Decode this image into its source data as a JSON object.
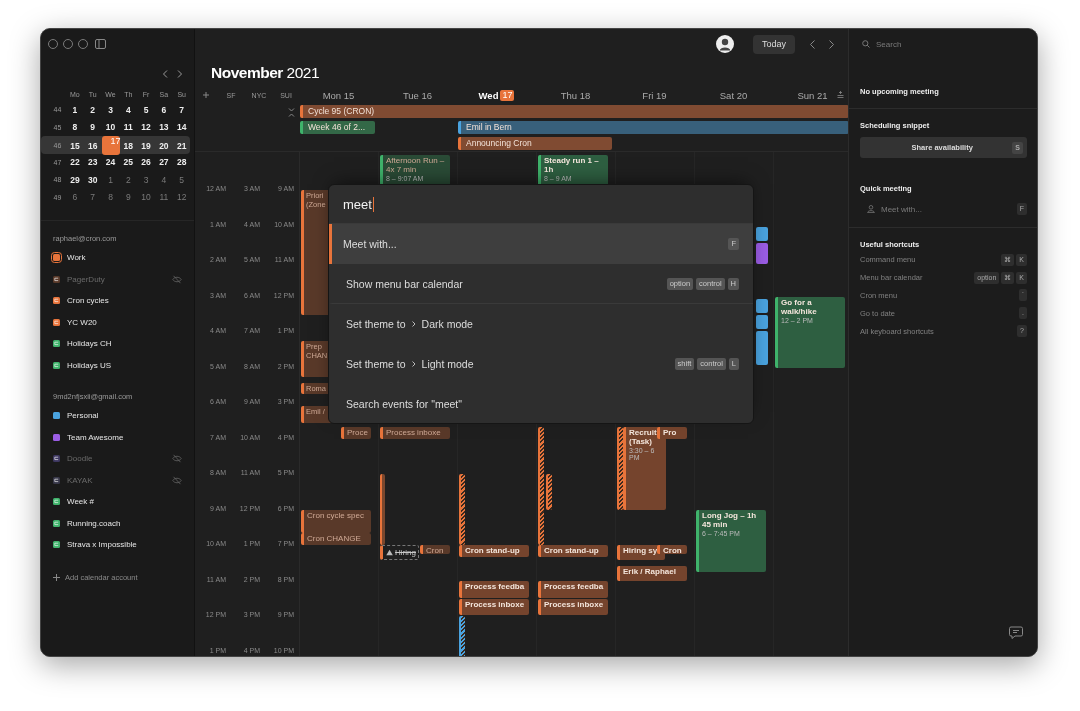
{
  "sidebar": {
    "mini_calendar": {
      "weekdays": [
        "Mo",
        "Tu",
        "We",
        "Th",
        "Fr",
        "Sa",
        "Su"
      ],
      "weeks": [
        {
          "number": "44",
          "selected": false,
          "days": [
            {
              "label": "1",
              "muted": false,
              "today": false
            },
            {
              "label": "2",
              "muted": false,
              "today": false
            },
            {
              "label": "3",
              "muted": false,
              "today": false
            },
            {
              "label": "4",
              "muted": false,
              "today": false
            },
            {
              "label": "5",
              "muted": false,
              "today": false
            },
            {
              "label": "6",
              "muted": false,
              "today": false
            },
            {
              "label": "7",
              "muted": false,
              "today": false
            }
          ]
        },
        {
          "number": "45",
          "selected": false,
          "days": [
            {
              "label": "8",
              "muted": false,
              "today": false
            },
            {
              "label": "9",
              "muted": false,
              "today": false
            },
            {
              "label": "10",
              "muted": false,
              "today": false
            },
            {
              "label": "11",
              "muted": false,
              "today": false
            },
            {
              "label": "12",
              "muted": false,
              "today": false
            },
            {
              "label": "13",
              "muted": false,
              "today": false
            },
            {
              "label": "14",
              "muted": false,
              "today": false
            }
          ]
        },
        {
          "number": "46",
          "selected": true,
          "days": [
            {
              "label": "15",
              "muted": false,
              "today": false
            },
            {
              "label": "16",
              "muted": false,
              "today": false
            },
            {
              "label": "17",
              "muted": false,
              "today": true
            },
            {
              "label": "18",
              "muted": false,
              "today": false
            },
            {
              "label": "19",
              "muted": false,
              "today": false
            },
            {
              "label": "20",
              "muted": false,
              "today": false
            },
            {
              "label": "21",
              "muted": false,
              "today": false
            }
          ]
        },
        {
          "number": "47",
          "selected": false,
          "days": [
            {
              "label": "22",
              "muted": false,
              "today": false
            },
            {
              "label": "23",
              "muted": false,
              "today": false
            },
            {
              "label": "24",
              "muted": false,
              "today": false
            },
            {
              "label": "25",
              "muted": false,
              "today": false
            },
            {
              "label": "26",
              "muted": false,
              "today": false
            },
            {
              "label": "27",
              "muted": false,
              "today": false
            },
            {
              "label": "28",
              "muted": false,
              "today": false
            }
          ]
        },
        {
          "number": "48",
          "selected": false,
          "days": [
            {
              "label": "29",
              "muted": false,
              "today": false
            },
            {
              "label": "30",
              "muted": false,
              "today": false
            },
            {
              "label": "1",
              "muted": true,
              "today": false
            },
            {
              "label": "2",
              "muted": true,
              "today": false
            },
            {
              "label": "3",
              "muted": true,
              "today": false
            },
            {
              "label": "4",
              "muted": true,
              "today": false
            },
            {
              "label": "5",
              "muted": true,
              "today": false
            }
          ]
        },
        {
          "number": "49",
          "selected": false,
          "days": [
            {
              "label": "6",
              "muted": true,
              "today": false
            },
            {
              "label": "7",
              "muted": true,
              "today": false
            },
            {
              "label": "8",
              "muted": true,
              "today": false
            },
            {
              "label": "9",
              "muted": true,
              "today": false
            },
            {
              "label": "10",
              "muted": true,
              "today": false
            },
            {
              "label": "11",
              "muted": true,
              "today": false
            },
            {
              "label": "12",
              "muted": true,
              "today": false
            }
          ]
        }
      ]
    },
    "accounts": [
      {
        "email": "raphael@cron.com",
        "calendars": [
          {
            "name": "Work",
            "color": "#e8743b",
            "kind": "plain",
            "selected": true,
            "hidden": false
          },
          {
            "name": "PagerDuty",
            "color": "#5a3a2a",
            "kind": "synced",
            "selected": false,
            "hidden": true
          },
          {
            "name": "Cron cycles",
            "color": "#e8743b",
            "kind": "synced",
            "selected": false,
            "hidden": false
          },
          {
            "name": "YC W20",
            "color": "#e8743b",
            "kind": "synced",
            "selected": false,
            "hidden": false
          },
          {
            "name": "Holidays CH",
            "color": "#3fb36b",
            "kind": "synced",
            "selected": false,
            "hidden": false
          },
          {
            "name": "Holidays US",
            "color": "#3fb36b",
            "kind": "synced",
            "selected": false,
            "hidden": false
          }
        ]
      },
      {
        "email": "9md2nfjsxii@gmail.com",
        "calendars": [
          {
            "name": "Personal",
            "color": "#4aa3df",
            "kind": "plain",
            "selected": false,
            "hidden": false
          },
          {
            "name": "Team Awesome",
            "color": "#9b5de5",
            "kind": "plain",
            "selected": false,
            "hidden": false
          },
          {
            "name": "Doodle",
            "color": "#3d3760",
            "kind": "synced",
            "selected": false,
            "hidden": true
          },
          {
            "name": "KAYAK",
            "color": "#38384a",
            "kind": "synced",
            "selected": false,
            "hidden": true
          },
          {
            "name": "Week #",
            "color": "#3fb36b",
            "kind": "synced",
            "selected": false,
            "hidden": false
          },
          {
            "name": "Running.coach",
            "color": "#3fb36b",
            "kind": "synced",
            "selected": false,
            "hidden": false
          },
          {
            "name": "Strava x Impossible",
            "color": "#3fb36b",
            "kind": "synced",
            "selected": false,
            "hidden": false
          }
        ]
      }
    ],
    "add_account": "Add calendar account"
  },
  "header": {
    "month_title": "**November** 2021",
    "today_button": "Today"
  },
  "timezones": [
    "SF",
    "NYC",
    "SUI"
  ],
  "days": [
    {
      "name": "Mon",
      "date": "15",
      "today": false,
      "all_day": [
        {
          "title": "Cycle 95 (CRON)",
          "color": "#e8743b"
        },
        {
          "title": "Week 46 of 2...",
          "color": "#3fb36b"
        }
      ],
      "events": [
        {
          "title": "Priori (Zone",
          "color": "#e8743b",
          "kind": "covered",
          "past": true
        },
        {
          "title": "Prep CHAN",
          "color": "#e8743b",
          "kind": "covered",
          "past": true
        },
        {
          "title": "Roma",
          "color": "#e8743b",
          "kind": "covered",
          "past": true
        },
        {
          "title": "Emil /",
          "color": "#e8743b",
          "kind": "covered",
          "past": true
        },
        {
          "title": "Proce",
          "color": "#e8743b",
          "kind": "side",
          "past": true
        },
        {
          "title": "Cron cycle spec",
          "color": "#e8743b",
          "kind": "block",
          "past": true
        },
        {
          "title": "Cron CHANGE",
          "color": "#e8743b",
          "kind": "block",
          "past": true
        }
      ]
    },
    {
      "name": "Tue",
      "date": "16",
      "today": false,
      "events": [
        {
          "title": "Afternoon Run – 4x 7 min",
          "time": "8 – 9:07 AM",
          "color": "#3fb36b",
          "kind": "block",
          "past": true
        },
        {
          "title": "Process inboxe",
          "color": "#e8743b",
          "kind": "block",
          "past": true
        },
        {
          "color": "#e8743b",
          "kind": "bar",
          "past": true
        },
        {
          "title": "Hiring",
          "color": "#e8743b",
          "kind": "tentative",
          "past": true
        },
        {
          "title": "Cron",
          "color": "#e8743b",
          "kind": "side",
          "past": true
        }
      ]
    },
    {
      "name": "Wed",
      "date": "17",
      "today": true,
      "all_day": [
        {
          "title": "Emil in Bern",
          "color": "#4aa3df"
        },
        {
          "title": "Announcing Cron",
          "color": "#e8743b"
        }
      ],
      "events": [
        {
          "color": "#e8743b",
          "kind": "stripe",
          "past": false
        },
        {
          "title": "Cron stand-up",
          "color": "#e8743b",
          "kind": "block",
          "past": false
        },
        {
          "title": "Process feedba",
          "color": "#e8743b",
          "kind": "block",
          "past": false
        },
        {
          "title": "Process inboxe",
          "color": "#e8743b",
          "kind": "block",
          "past": false
        },
        {
          "color": "#4aa3df",
          "kind": "stripe",
          "past": false
        }
      ]
    },
    {
      "name": "Thu",
      "date": "18",
      "today": false,
      "events": [
        {
          "title": "Steady run 1 – 1h",
          "time": "8 – 9 AM",
          "color": "#3fb36b",
          "kind": "block",
          "past": false
        },
        {
          "color": "#e8743b",
          "kind": "stripe",
          "past": false
        },
        {
          "color": "#e8743b",
          "kind": "stripe_inset",
          "past": false
        },
        {
          "title": "Cron stand-up",
          "color": "#e8743b",
          "kind": "block",
          "past": false
        },
        {
          "title": "Process feedba",
          "color": "#e8743b",
          "kind": "block",
          "past": false
        },
        {
          "title": "Process inboxe",
          "color": "#e8743b",
          "kind": "block",
          "past": false
        }
      ]
    },
    {
      "name": "Fri",
      "date": "19",
      "today": false,
      "events": [
        {
          "color": "#e8743b",
          "kind": "stripe",
          "past": false
        },
        {
          "title": "Recruit (Task)",
          "time": "3:30 – 6 PM",
          "color": "#e8743b",
          "kind": "inset",
          "past": false
        },
        {
          "title": "Pro",
          "color": "#e8743b",
          "kind": "side",
          "past": false
        },
        {
          "title": "Hiring sy",
          "color": "#e8743b",
          "kind": "main",
          "past": false
        },
        {
          "title": "Cron",
          "color": "#e8743b",
          "kind": "side",
          "past": false
        },
        {
          "title": "Erik / Raphael",
          "color": "#e8743b",
          "kind": "block",
          "past": false
        }
      ]
    },
    {
      "name": "Sat",
      "date": "20",
      "today": false,
      "events": [
        {
          "color": "#4aa3df",
          "kind": "clipped",
          "past": false
        },
        {
          "color": "#9b5de5",
          "kind": "clipped",
          "past": false
        },
        {
          "color": "#4aa3df",
          "kind": "clipped",
          "past": false
        },
        {
          "color": "#4aa3df",
          "kind": "clipped",
          "past": false
        },
        {
          "color": "#4aa3df",
          "kind": "clipped",
          "past": false
        },
        {
          "title": "Long Jog – 1h 45 min",
          "time": "6 – 7:45 PM",
          "color": "#3fb36b",
          "kind": "block",
          "past": false
        }
      ]
    },
    {
      "name": "Sun",
      "date": "21",
      "today": false,
      "events": [
        {
          "title": "Go for a walk/hike",
          "time": "12 – 2 PM",
          "color": "#3fb36b",
          "kind": "block",
          "past": false
        }
      ]
    }
  ],
  "time_rows": [
    [
      "12 AM",
      "3 AM",
      "9 AM"
    ],
    [
      "1 AM",
      "4 AM",
      "10 AM"
    ],
    [
      "2 AM",
      "5 AM",
      "11 AM"
    ],
    [
      "3 AM",
      "6 AM",
      "12 PM"
    ],
    [
      "4 AM",
      "7 AM",
      "1 PM"
    ],
    [
      "5 AM",
      "8 AM",
      "2 PM"
    ],
    [
      "6 AM",
      "9 AM",
      "3 PM"
    ],
    [
      "7 AM",
      "10 AM",
      "4 PM"
    ],
    [
      "8 AM",
      "11 AM",
      "5 PM"
    ],
    [
      "9 AM",
      "12 PM",
      "6 PM"
    ],
    [
      "10 AM",
      "1 PM",
      "7 PM"
    ],
    [
      "11 AM",
      "2 PM",
      "8 PM"
    ],
    [
      "12 PM",
      "3 PM",
      "9 PM"
    ],
    [
      "1 PM",
      "4 PM",
      "10 PM"
    ]
  ],
  "command_menu": {
    "query": "meet",
    "items": [
      {
        "label": "Meet with...",
        "selected": true,
        "section_end": false,
        "keys": [
          "F"
        ]
      },
      {
        "label": "Show menu bar calendar",
        "selected": false,
        "section_end": true,
        "keys": [
          "option",
          "control",
          "H"
        ]
      },
      {
        "label": "Set theme to",
        "target": "Dark mode",
        "selected": false,
        "section_end": false
      },
      {
        "label": "Set theme to",
        "target": "Light mode",
        "selected": false,
        "section_end": false,
        "keys": [
          "shift",
          "control",
          "L"
        ]
      },
      {
        "label": "Search events for \"meet\"",
        "selected": false
      }
    ]
  },
  "right_panel": {
    "search": {
      "placeholder": "Search"
    },
    "next_meeting": "No upcoming meeting",
    "scheduling": {
      "heading": "Scheduling snippet",
      "button": "Share availability",
      "key": "S"
    },
    "quick_meeting": {
      "heading": "Quick meeting",
      "placeholder": "Meet with...",
      "key": "F"
    },
    "shortcuts": {
      "heading": "Useful shortcuts",
      "items": [
        {
          "label": "Command menu",
          "keys": [
            "⌘",
            "K"
          ]
        },
        {
          "label": "Menu bar calendar",
          "keys": [
            "option",
            "⌘",
            "K"
          ]
        },
        {
          "label": "Cron menu",
          "keys": [
            "`"
          ]
        },
        {
          "label": "Go to date",
          "keys": [
            "."
          ]
        },
        {
          "label": "All keyboard shortcuts",
          "keys": [
            "?"
          ]
        }
      ]
    }
  }
}
